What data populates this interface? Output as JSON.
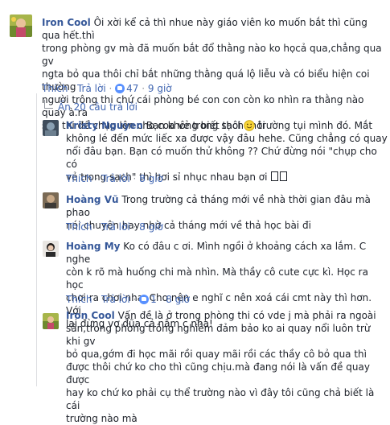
{
  "labels": {
    "like": "Thích",
    "reply": "Trả lời",
    "sep": "·"
  },
  "colors": {
    "link": "#4267b2",
    "name": "#365899",
    "meta": "#90949c",
    "like_badge": "#5890ff"
  },
  "main_comment": {
    "name": "Iron Cool",
    "line1": "Ôi xời kể cả thì nhue này giáo viên ko muốn bắt thì cũng qua hết.thì",
    "line2": "trong phòng gv mà đã muốn bắt đổ thằng nào ko họcả qua,chẳng qua gv",
    "line3": "ngta bỏ qua thôi chỉ bắt những thằng quá lộ liễu và có biểu hiện coi thường",
    "line4": "người trông thi chứ cái phòng bé con con còn ko nhìn ra thằng nào quay à.ra",
    "line5": "sân thi để chụp lên cho coa vẻ trong sạch thôi",
    "likes": "47",
    "time": "9 giờ"
  },
  "replies_toggle": "Ẩn 20 câu trả lời",
  "replies": [
    {
      "name": "Kristy Nguyen",
      "line1a": "Bạn không biết thôi",
      "line1b": "trường tụi mình đó. Mắt",
      "line2": "không lé đến mức liếc xa được vậy đâu hehe. Cũng chẳng có quay",
      "line3": "nổi đâu bạn. Bạn có muốn thử không ?? Chứ đừng nói \"chụp cho có",
      "line4a": "vẻ trong sạch\" thì hơi sỉ nhục nhau bạn ơi",
      "time": "8 giờ"
    },
    {
      "name": "Hoàng Vũ",
      "line1": "Trong trường cả tháng mới về nhà thời gian đâu mà phao",
      "line2": "nói chuyện hay nhờ cả tháng mới về thả học bài đi",
      "time": "8 giờ"
    },
    {
      "name": "Hoàng My",
      "line1": "Ko có đâu c ơi. Mình ngồi ở khoảng cách xa lắm. C nghe",
      "line2": "còn k rõ mà huống chi mà nhìn. Mà thầy cô cute cực kì. Học ra học",
      "line3": "chơi ra chơi nha. Cho nên e nghĩ c nên xoá cái cmt này thì hơn. Với",
      "line4": "lại đừng vơ đũa cả nắm c nha!",
      "likes": "1",
      "time": "8 giờ"
    },
    {
      "name": "Iron Cool",
      "line1": "Vấn đề là ở trong phòng thi có vde j mà phải ra ngoài",
      "line2": "sân,trong phòng trông nghiêm đảm bảo ko ai quay nổi luôn trừ khi gv",
      "line3": "bỏ qua,gớm đi học mãi rồi quay mãi rồi các thầy cô bỏ qua thì",
      "line4": "được thôi chứ ko cho thì cũng chịu.mà đang nói là vấn đề quay được",
      "line5": "hay ko chứ ko phải cụ thể trường nào vì đây tôi cũng chả biết là cái",
      "line6": "trường nào mà"
    }
  ]
}
